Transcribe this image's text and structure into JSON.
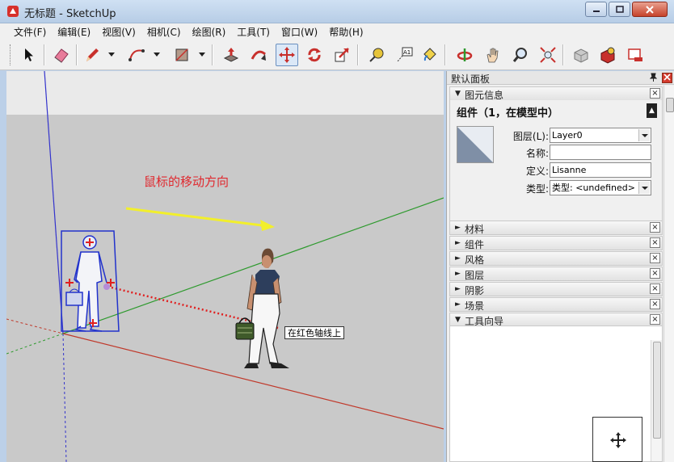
{
  "window": {
    "title": "无标题 - SketchUp",
    "min": "0",
    "max": "1",
    "close": "r"
  },
  "menu": [
    "文件(F)",
    "编辑(E)",
    "视图(V)",
    "相机(C)",
    "绘图(R)",
    "工具(T)",
    "窗口(W)",
    "帮助(H)"
  ],
  "toolbar": {
    "tools": [
      "select",
      "eraser",
      "pencil",
      "arc",
      "rectangle",
      "push-pull",
      "follow-me",
      "move",
      "rotate",
      "scale",
      "tape-measure",
      "text",
      "paint-bucket",
      "orbit",
      "pan",
      "zoom",
      "zoom-extents",
      "warehouse",
      "components",
      "extensions"
    ],
    "active": "move"
  },
  "viewport": {
    "annotation": "鼠标的移动方向",
    "tooltip": "在红色轴线上",
    "colors": {
      "annotation": "#e0282e",
      "arrow": "#f2ef2b",
      "red_axis": "#c0392b",
      "green_axis": "#2e9a2e",
      "blue_axis": "#3333cc",
      "selection": "#2233cc"
    }
  },
  "tray": {
    "title": "默认面板",
    "entity_info": {
      "label": "图元信息",
      "heading": "组件（1，在模型中）",
      "layer_label": "图层(L):",
      "layer_value": "Layer0",
      "name_label": "名称:",
      "name_value": "",
      "definition_label": "定义:",
      "definition_value": "Lisanne",
      "type_label": "类型:",
      "type_value": "类型: <undefined>"
    },
    "sections": [
      "材料",
      "组件",
      "风格",
      "图层",
      "阴影",
      "场景"
    ],
    "instructor": "工具向导"
  }
}
